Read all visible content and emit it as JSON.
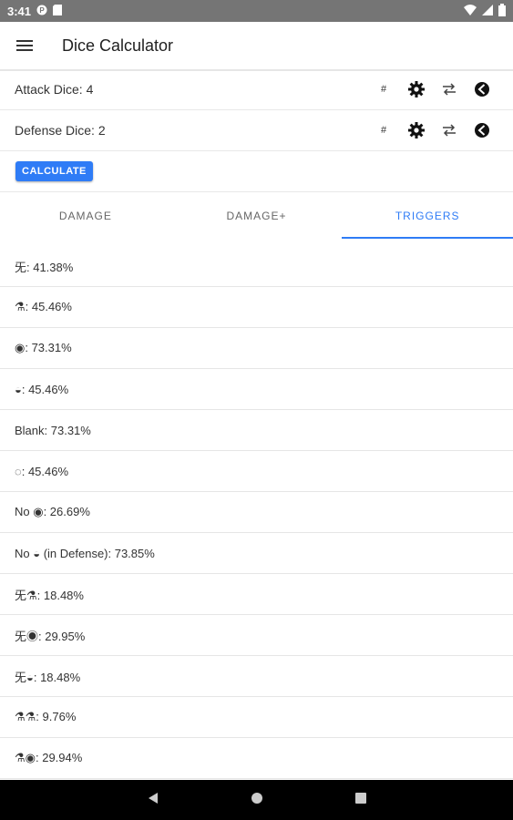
{
  "status_bar": {
    "time": "3:41"
  },
  "app_bar": {
    "title": "Dice Calculator"
  },
  "dice": [
    {
      "label": "Attack Dice: 4"
    },
    {
      "label": "Defense Dice: 2"
    }
  ],
  "icons": {
    "hash": "#",
    "settings": "gear-icon",
    "swap": "swap-icon",
    "remove": "minus-circle-icon"
  },
  "calculate_label": "CALCULATE",
  "tabs": [
    {
      "label": "DAMAGE",
      "active": false
    },
    {
      "label": "DAMAGE+",
      "active": false
    },
    {
      "label": "TRIGGERS",
      "active": true
    }
  ],
  "results": [
    "⺛: 41.38%",
    "⚗: 45.46%",
    "◉: 73.31%",
    "◒: 45.46%",
    "Blank: 73.31%",
    "◌: 45.46%",
    "No ◉: 26.69%",
    "No ◒ (in Defense): 73.85%",
    "⺛⚗: 18.48%",
    "⺛◉: 29.95%",
    "⺛◒: 18.48%",
    "⚗⚗: 9.76%",
    "⚗◉: 29.94%"
  ],
  "colors": {
    "accent": "#2f7cf6",
    "status_bar": "#757575",
    "nav_bar": "#000000"
  }
}
